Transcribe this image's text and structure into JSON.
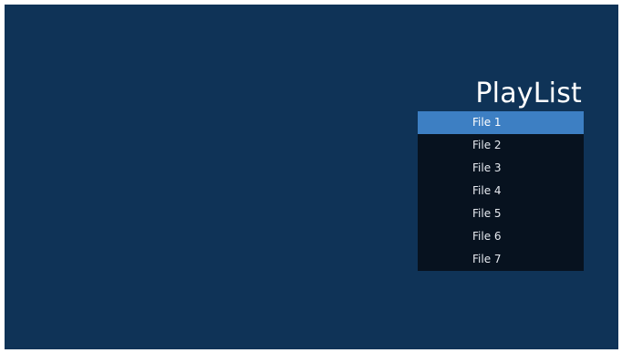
{
  "title": "PlayList",
  "playlist": {
    "items": [
      {
        "label": "File 1",
        "selected": true
      },
      {
        "label": "File 2",
        "selected": false
      },
      {
        "label": "File 3",
        "selected": false
      },
      {
        "label": "File 4",
        "selected": false
      },
      {
        "label": "File 5",
        "selected": false
      },
      {
        "label": "File 6",
        "selected": false
      },
      {
        "label": "File 7",
        "selected": false
      }
    ]
  },
  "colors": {
    "background": "#0f3357",
    "panel": "#07121f",
    "selected": "#3d7fc3",
    "text": "#ffffff"
  }
}
